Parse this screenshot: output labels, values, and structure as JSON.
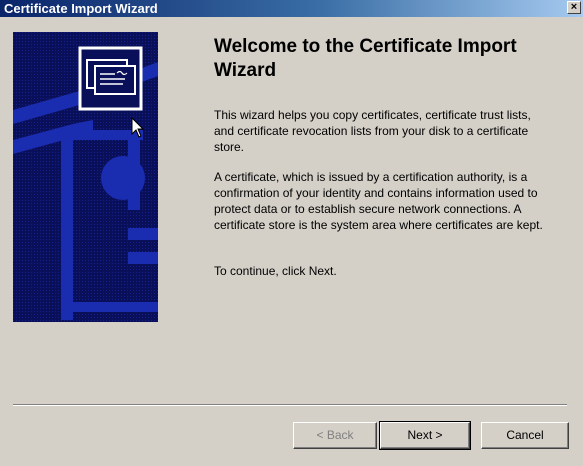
{
  "window": {
    "title": "Certificate Import Wizard",
    "close_glyph": "×"
  },
  "content": {
    "heading": "Welcome to the Certificate Import Wizard",
    "paragraph1": "This wizard helps you copy certificates, certificate trust lists, and certificate revocation lists from your disk to a certificate store.",
    "paragraph2": "A certificate, which is issued by a certification authority, is a confirmation of your identity and contains information used to protect data or to establish secure network connections. A certificate store is the system area where certificates are kept.",
    "paragraph3": "To continue, click Next."
  },
  "buttons": {
    "back": "< Back",
    "next": "Next >",
    "cancel": "Cancel"
  },
  "colors": {
    "titlebar_start": "#0a246a",
    "banner_bg": "#0a0f5a",
    "window_bg": "#d4d0c8"
  },
  "icons": {
    "banner": "certificate-icon",
    "close": "close-icon",
    "cursor": "mouse-pointer-icon"
  }
}
